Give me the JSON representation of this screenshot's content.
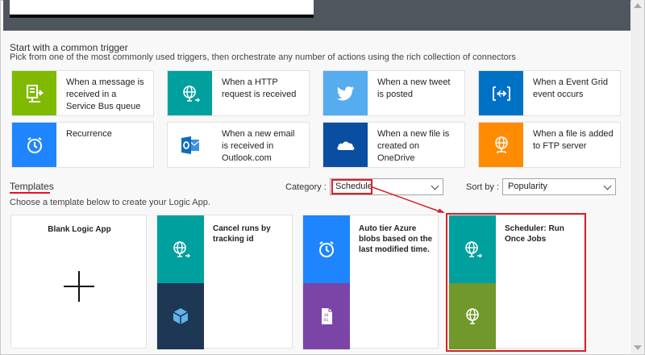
{
  "colors": {
    "service_bus": "#7fba00",
    "http": "#00a09e",
    "twitter": "#55acee",
    "event_grid": "#0072c6",
    "recurrence": "#1f85ff",
    "outlook": "#0f6cbd",
    "onedrive": "#0a4ea2",
    "ftp": "#ff8c00",
    "template_teal": "#00a09e",
    "template_navy": "#1e3755",
    "template_purple": "#7b45a8",
    "template_olive": "#70982a",
    "highlight": "#d9202a"
  },
  "triggers": {
    "title": "Start with a common trigger",
    "subtitle": "Pick from one of the most commonly used triggers, then orchestrate any number of actions using the rich collection of connectors",
    "items": [
      {
        "label": "When a message is received in a Service Bus queue",
        "icon": "service-bus-icon"
      },
      {
        "label": "When a HTTP request is received",
        "icon": "globe-icon"
      },
      {
        "label": "When a new tweet is posted",
        "icon": "twitter-icon"
      },
      {
        "label": "When a Event Grid event occurs",
        "icon": "event-grid-icon"
      },
      {
        "label": "Recurrence",
        "icon": "clock-icon"
      },
      {
        "label": "When a new email is received in Outlook.com",
        "icon": "outlook-icon"
      },
      {
        "label": "When a new file is created on OneDrive",
        "icon": "onedrive-icon"
      },
      {
        "label": "When a file is added to FTP server",
        "icon": "ftp-icon"
      }
    ]
  },
  "templates": {
    "heading": "Templates",
    "subtitle": "Choose a template below to create your Logic App.",
    "category_label": "Category :",
    "category_value": "Schedule",
    "sort_label": "Sort by :",
    "sort_value": "Popularity",
    "blank_title": "Blank Logic App",
    "items": [
      {
        "title": "Cancel runs by tracking id",
        "icon_top": "globe-icon",
        "icon_bottom": "cube-icon"
      },
      {
        "title": "Auto tier Azure blobs based on the last modified time.",
        "icon_top": "clock-icon",
        "icon_bottom": "blob-icon"
      },
      {
        "title": "Scheduler: Run Once Jobs",
        "icon_top": "globe-icon",
        "icon_bottom": "globe-icon"
      }
    ]
  }
}
